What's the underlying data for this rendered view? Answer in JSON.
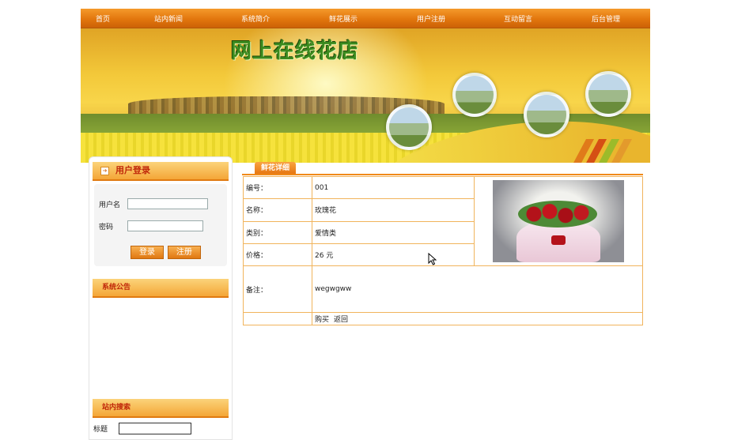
{
  "nav": {
    "items": [
      "首页",
      "站内新闻",
      "系统简介",
      "鲜花展示",
      "用户注册",
      "互动留言",
      "后台管理"
    ]
  },
  "banner": {
    "title": "网上在线花店"
  },
  "sidebar": {
    "login": {
      "title": "用户登录",
      "username_label": "用户名",
      "password_label": "密码",
      "login_button": "登录",
      "register_button": "注册"
    },
    "notice": {
      "title": "系统公告"
    },
    "search": {
      "title": "站内搜索",
      "title_label": "标题"
    }
  },
  "main": {
    "tab": "鲜花详细",
    "rows": [
      {
        "label": "编号：",
        "value": "001"
      },
      {
        "label": "名称：",
        "value": "玫瑰花"
      },
      {
        "label": "类别：",
        "value": "爱情类"
      },
      {
        "label": "价格：",
        "value": "26 元"
      }
    ],
    "remark_label": "备注：",
    "remark_value": "wegwgww",
    "actions": [
      "购买",
      "返回"
    ]
  },
  "colors": {
    "nav_orange": "#e2760d",
    "accent_red": "#c0280a",
    "border_orange": "#f1b45c"
  }
}
